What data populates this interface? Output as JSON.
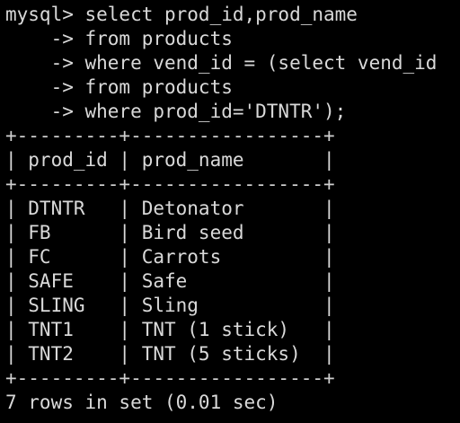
{
  "terminal": {
    "query_lines": [
      "mysql> select prod_id,prod_name",
      "    -> from products",
      "    -> where vend_id = (select vend_id",
      "    -> from products",
      "    -> where prod_id='DTNTR');"
    ],
    "border": "+---------+-----------------+",
    "header": "| prod_id | prod_name       |",
    "rows": [
      "| DTNTR   | Detonator       |",
      "| FB      | Bird seed       |",
      "| FC      | Carrots         |",
      "| SAFE    | Safe            |",
      "| SLING   | Sling           |",
      "| TNT1    | TNT (1 stick)   |",
      "| TNT2    | TNT (5 sticks)  |"
    ],
    "status": "7 rows in set (0.01 sec)"
  }
}
